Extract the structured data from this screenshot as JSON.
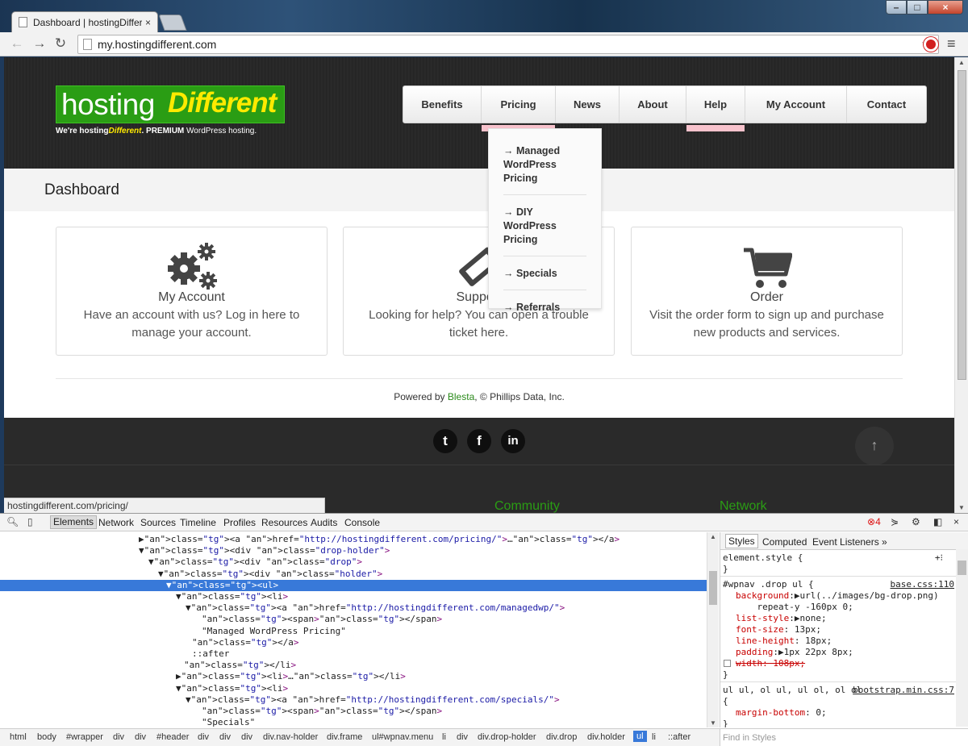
{
  "browser": {
    "tab_title": "Dashboard | hostingDiffer",
    "tab_close": "×",
    "url": "my.hostingdifferent.com",
    "status_url": "hostingdifferent.com/pricing/"
  },
  "site": {
    "logo_part1": "hosting",
    "logo_part2": "Different",
    "tagline_pre": "We're hosting",
    "tagline_em": "Different",
    "tagline_mid": ". PREMIUM ",
    "tagline_post": "WordPress hosting.",
    "nav": [
      "Benefits",
      "Pricing",
      "News",
      "About",
      "Help",
      "My Account",
      "Contact"
    ],
    "dropdown": [
      "→ Managed WordPress Pricing",
      "→ DIY WordPress Pricing",
      "→ Specials",
      "→ Referrals"
    ],
    "page_title": "Dashboard",
    "cards": [
      {
        "title": "My Account",
        "desc": "Have an account with us? Log in here to manage your account."
      },
      {
        "title": "Support",
        "desc": "Looking for help? You can open a trouble ticket here."
      },
      {
        "title": "Order",
        "desc": "Visit the order form to sign up and purchase new products and services."
      }
    ],
    "powered_pre": "Powered by ",
    "powered_link": "Blesta",
    "powered_post": ", © Phillips Data, Inc.",
    "social": [
      "t",
      "f",
      "in"
    ],
    "to_top": "↑",
    "footer_cols": [
      "Community",
      "Network"
    ]
  },
  "devtools": {
    "tabs": [
      "Elements",
      "Network",
      "Sources",
      "Timeline",
      "Profiles",
      "Resources",
      "Audits",
      "Console"
    ],
    "error_count": "4",
    "styles_tabs": [
      "Styles",
      "Computed",
      "Event Listeners",
      "»"
    ],
    "breadcrumbs": [
      "html",
      "body",
      "#wrapper",
      "div",
      "div",
      "#header",
      "div",
      "div",
      "div",
      "div.nav-holder",
      "div.frame",
      "ul#wpnav.menu",
      "li",
      "div",
      "div.drop-holder",
      "div.drop",
      "div.holder",
      "ul",
      "li",
      "::after"
    ],
    "find_placeholder": "Find in Styles",
    "dom_lines": [
      {
        "indent": 172,
        "text": "▶<a href=\"http://hostingdifferent.com/pricing/\">…</a>"
      },
      {
        "indent": 172,
        "text": "▼<div class=\"drop-holder\">"
      },
      {
        "indent": 184,
        "text": "▼<div class=\"drop\">"
      },
      {
        "indent": 196,
        "text": "▼<div class=\"holder\">"
      },
      {
        "indent": 206,
        "text": "▼<ul>"
      },
      {
        "indent": 218,
        "text": "▼<li>"
      },
      {
        "indent": 230,
        "text": "▼<a href=\"http://hostingdifferent.com/managedwp/\">"
      },
      {
        "indent": 250,
        "text": "<span></span>"
      },
      {
        "indent": 250,
        "text": "\"Managed WordPress Pricing\""
      },
      {
        "indent": 238,
        "text": "</a>"
      },
      {
        "indent": 238,
        "text": "::after"
      },
      {
        "indent": 228,
        "text": "</li>"
      },
      {
        "indent": 218,
        "text": "▶<li>…</li>"
      },
      {
        "indent": 218,
        "text": "▼<li>"
      },
      {
        "indent": 230,
        "text": "▼<a href=\"http://hostingdifferent.com/specials/\">"
      },
      {
        "indent": 250,
        "text": "<span></span>"
      },
      {
        "indent": 250,
        "text": "\"Specials\""
      }
    ],
    "styles": {
      "element_style": "element.style {",
      "close": "}",
      "rule1_selector": "#wpnav .drop ul {",
      "rule1_source": "base.css:110",
      "rule1_props": [
        {
          "name": "background",
          "value": ":▶url(../images/bg-drop.png)"
        },
        {
          "name": "",
          "value": "    repeat-y -160px 0;"
        },
        {
          "name": "list-style",
          "value": ":▶none;"
        },
        {
          "name": "font-size",
          "value": ": 13px;"
        },
        {
          "name": "line-height",
          "value": ": 18px;"
        },
        {
          "name": "padding",
          "value": ":▶1px 22px 8px;"
        }
      ],
      "rule1_struck": "width: 108px;",
      "rule2_selector": "ul ul, ol ul, ul ol, ol ol",
      "rule2_source": "bootstrap.min.css:7",
      "rule2_open": "{",
      "rule2_prop": "margin-bottom",
      "rule2_value": ": 0;"
    }
  }
}
